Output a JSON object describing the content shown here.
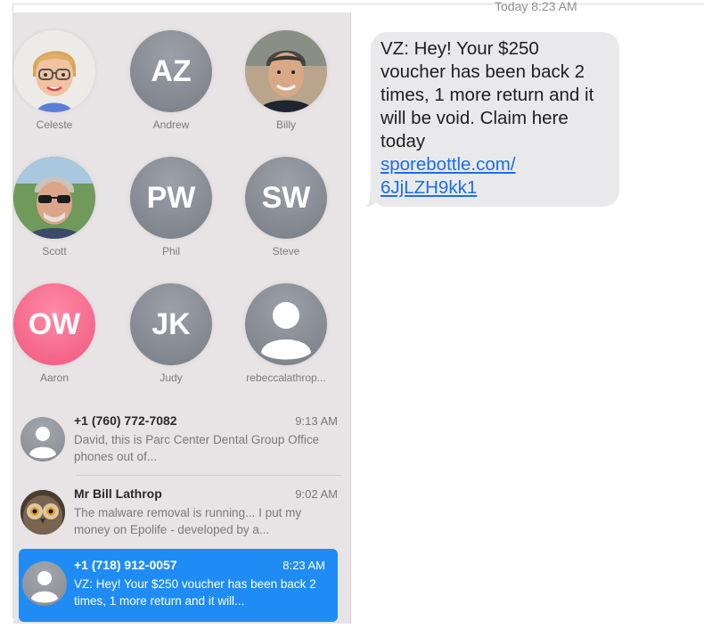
{
  "pinned": [
    {
      "name": "Celeste",
      "initials": "",
      "kind": "photo",
      "photo": "memoji-celeste"
    },
    {
      "name": "Andrew",
      "initials": "AZ",
      "kind": "initials"
    },
    {
      "name": "Billy",
      "initials": "",
      "kind": "photo",
      "photo": "photo-billy"
    },
    {
      "name": "Scott",
      "initials": "",
      "kind": "photo",
      "photo": "photo-scott"
    },
    {
      "name": "Phil",
      "initials": "PW",
      "kind": "initials"
    },
    {
      "name": "Steve",
      "initials": "SW",
      "kind": "initials"
    },
    {
      "name": "Aaron",
      "initials": "OW",
      "kind": "initials",
      "color": "#f4668a"
    },
    {
      "name": "Judy",
      "initials": "JK",
      "kind": "initials"
    },
    {
      "name": "rebeccalathrop...",
      "initials": "",
      "kind": "placeholder"
    }
  ],
  "conversations": [
    {
      "name": "+1 (760) 772-7082",
      "time": "9:13 AM",
      "preview": "David, this is Parc Center Dental Group Office phones out of...",
      "avatar": "person-placeholder-icon",
      "selected": false
    },
    {
      "name": "Mr Bill Lathrop",
      "time": "9:02 AM",
      "preview": "The malware removal is running... I put my money on Epolife - developed by a...",
      "avatar": "owl-photo",
      "selected": false
    },
    {
      "name": "+1 (718) 912-0057",
      "time": "8:23 AM",
      "preview": "VZ: Hey! Your $250 voucher has been back 2 times, 1 more return and it will...",
      "avatar": "person-placeholder-icon",
      "selected": true
    }
  ],
  "thread": {
    "timestamp": "Today 8:23 AM",
    "message_text": "VZ: Hey! Your $250 voucher has been back 2 times, 1 more return and it will be void. Claim here today",
    "message_link_line1": "sporebottle.com/",
    "message_link_line2": "6JjLZH9kk1"
  },
  "colors": {
    "sidebar_bg": "#e8e4e6",
    "selected_bg": "#1f8cf5",
    "bubble_bg": "#e9e9eb",
    "link": "#1a6ee8",
    "avatar_gray": "#8c9097",
    "avatar_pink": "#f4668a"
  }
}
